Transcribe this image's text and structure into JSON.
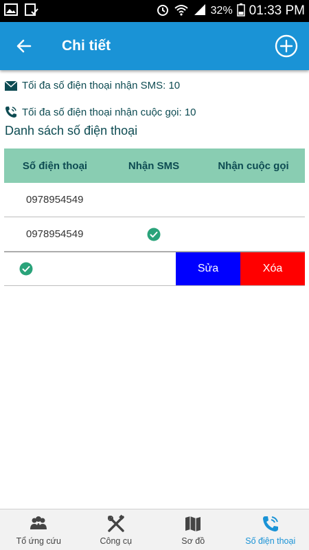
{
  "status_bar": {
    "battery": "32%",
    "time": "01:33 PM"
  },
  "header": {
    "title": "Chi tiết"
  },
  "info": {
    "sms_limit": "Tối đa số điện thoại nhận SMS: 10",
    "call_limit": "Tối đa số điện thoại nhận cuộc gọi: 10"
  },
  "section_title": "Danh sách số điện thoại",
  "table": {
    "headers": [
      "Số điện thoại",
      "Nhận SMS",
      "Nhận cuộc gọi"
    ],
    "rows": [
      {
        "phone": "0978954549",
        "sms": false,
        "call": false
      },
      {
        "phone": "0978954549",
        "sms": true,
        "call": false
      }
    ],
    "swipe_actions": {
      "edit": "Sửa",
      "delete": "Xóa"
    }
  },
  "bottom_nav": {
    "items": [
      {
        "label": "Tổ ứng cứu",
        "icon": "group-icon"
      },
      {
        "label": "Công cụ",
        "icon": "tools-icon"
      },
      {
        "label": "Sơ đồ",
        "icon": "map-icon"
      },
      {
        "label": "Số điện thoại",
        "icon": "phone-call-icon"
      }
    ]
  },
  "colors": {
    "app_bar": "#1a93d6",
    "table_header": "#89cdb2",
    "check": "#2aa37a",
    "edit_button": "#0000ff",
    "delete_button": "#ff0000"
  }
}
